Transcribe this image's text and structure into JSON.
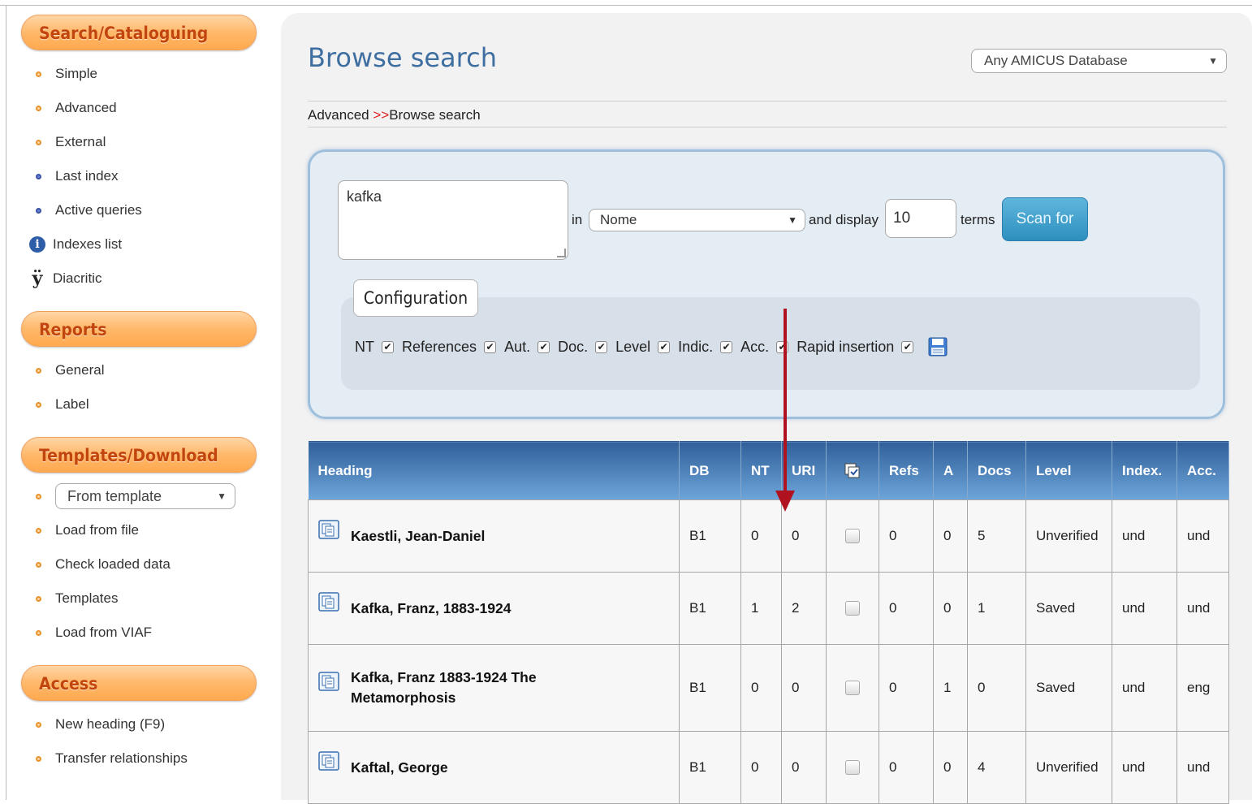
{
  "sidebar": {
    "sections": [
      {
        "title": "Search/Cataloguing",
        "items": [
          {
            "label": "Simple",
            "icon": "bullet-orange"
          },
          {
            "label": "Advanced",
            "icon": "bullet-orange"
          },
          {
            "label": "External",
            "icon": "bullet-orange"
          },
          {
            "label": "Last index",
            "icon": "bullet-blue"
          },
          {
            "label": "Active queries",
            "icon": "bullet-blue"
          },
          {
            "label": "Indexes list",
            "icon": "info-icon"
          },
          {
            "label": "Diacritic",
            "icon": "diacritic-icon"
          }
        ]
      },
      {
        "title": "Reports",
        "items": [
          {
            "label": "General",
            "icon": "bullet-orange"
          },
          {
            "label": "Label",
            "icon": "bullet-orange"
          }
        ]
      },
      {
        "title": "Templates/Download",
        "select_value": "From template",
        "items": [
          {
            "label": "Load from file",
            "icon": "bullet-orange"
          },
          {
            "label": "Check loaded data",
            "icon": "bullet-orange"
          },
          {
            "label": "Templates",
            "icon": "bullet-orange"
          },
          {
            "label": "Load from VIAF",
            "icon": "bullet-orange"
          }
        ]
      },
      {
        "title": "Access",
        "items": [
          {
            "label": "New heading (F9)",
            "icon": "bullet-orange"
          },
          {
            "label": "Transfer relationships",
            "icon": "bullet-orange"
          }
        ]
      }
    ]
  },
  "header": {
    "title": "Browse search",
    "database_select": "Any AMICUS Database"
  },
  "breadcrumb": {
    "parent": "Advanced",
    "separator": ">>",
    "current": "Browse search"
  },
  "search": {
    "query": "kafka",
    "in_label": "in",
    "index_select": "Nome",
    "display_label": "and display",
    "terms_value": "10",
    "terms_label": "terms",
    "scan_button": "Scan for"
  },
  "configuration": {
    "tab_label": "Configuration",
    "options": [
      {
        "label": "NT",
        "checked": true
      },
      {
        "label": "References",
        "checked": true
      },
      {
        "label": "Aut.",
        "checked": true
      },
      {
        "label": "Doc.",
        "checked": true
      },
      {
        "label": "Level",
        "checked": true
      },
      {
        "label": "Indic.",
        "checked": true
      },
      {
        "label": "Acc.",
        "checked": true
      },
      {
        "label": "Rapid insertion",
        "checked": true
      }
    ]
  },
  "table": {
    "columns": [
      "Heading",
      "DB",
      "NT",
      "URI",
      "",
      "Refs",
      "A",
      "Docs",
      "Level",
      "Index.",
      "Acc."
    ],
    "rows": [
      {
        "heading": "Kaestli, Jean-Daniel",
        "db": "B1",
        "nt": "0",
        "uri": "0",
        "refs": "0",
        "a": "0",
        "docs": "5",
        "level": "Unverified",
        "index": "und",
        "acc": "und"
      },
      {
        "heading": "Kafka, Franz, 1883-1924",
        "db": "B1",
        "nt": "1",
        "uri": "2",
        "refs": "0",
        "a": "0",
        "docs": "1",
        "level": "Saved",
        "index": "und",
        "acc": "und"
      },
      {
        "heading": "Kafka, Franz 1883-1924 The Metamorphosis",
        "db": "B1",
        "nt": "0",
        "uri": "0",
        "refs": "0",
        "a": "1",
        "docs": "0",
        "level": "Saved",
        "index": "und",
        "acc": "eng"
      },
      {
        "heading": "Kaftal, George",
        "db": "B1",
        "nt": "0",
        "uri": "0",
        "refs": "0",
        "a": "0",
        "docs": "4",
        "level": "Unverified",
        "index": "und",
        "acc": "und"
      }
    ]
  },
  "colors": {
    "accent_orange": "#ffb86a",
    "section_title": "#c2450e",
    "title_blue": "#3f6fa0",
    "table_header": "#4a7fb8",
    "scan_button": "#3a9ccb",
    "annotation_arrow": "#b1121f"
  }
}
